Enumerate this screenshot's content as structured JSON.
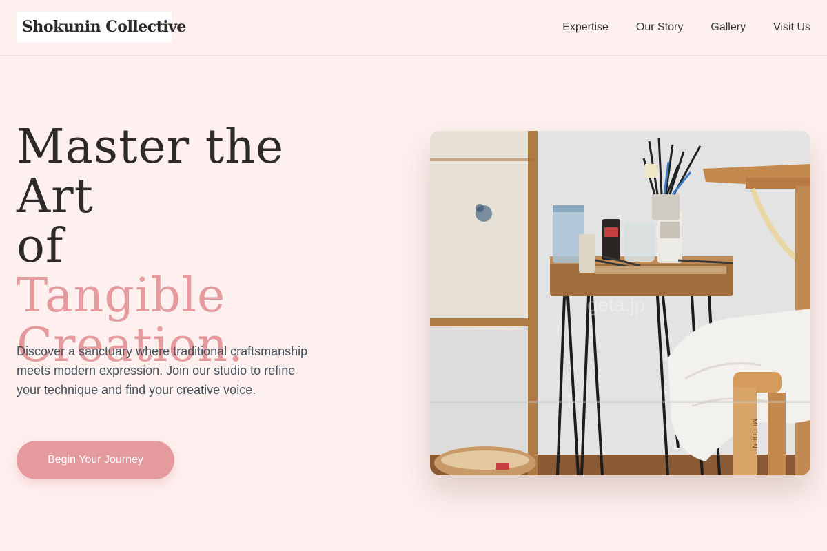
{
  "brand": {
    "name": "Shokunin Collective"
  },
  "nav": {
    "items": [
      {
        "label": "Expertise"
      },
      {
        "label": "Our Story"
      },
      {
        "label": "Gallery"
      },
      {
        "label": "Visit Us"
      }
    ]
  },
  "hero": {
    "title_line1": "Master the Art",
    "title_line2": "of",
    "title_accent_line1": "Tangible",
    "title_accent_line2": "Creation.",
    "description": "Discover a sanctuary where traditional craftsmanship meets modern expression. Join our studio to refine your technique and find your creative voice.",
    "cta_label": "Begin Your Journey",
    "image_watermark": "geta.jp",
    "stool_brand": "MEEDEN"
  },
  "colors": {
    "background": "#fdf0ee",
    "accent": "#e59a9e",
    "text": "#2d2a29",
    "body_text": "#44505a"
  }
}
